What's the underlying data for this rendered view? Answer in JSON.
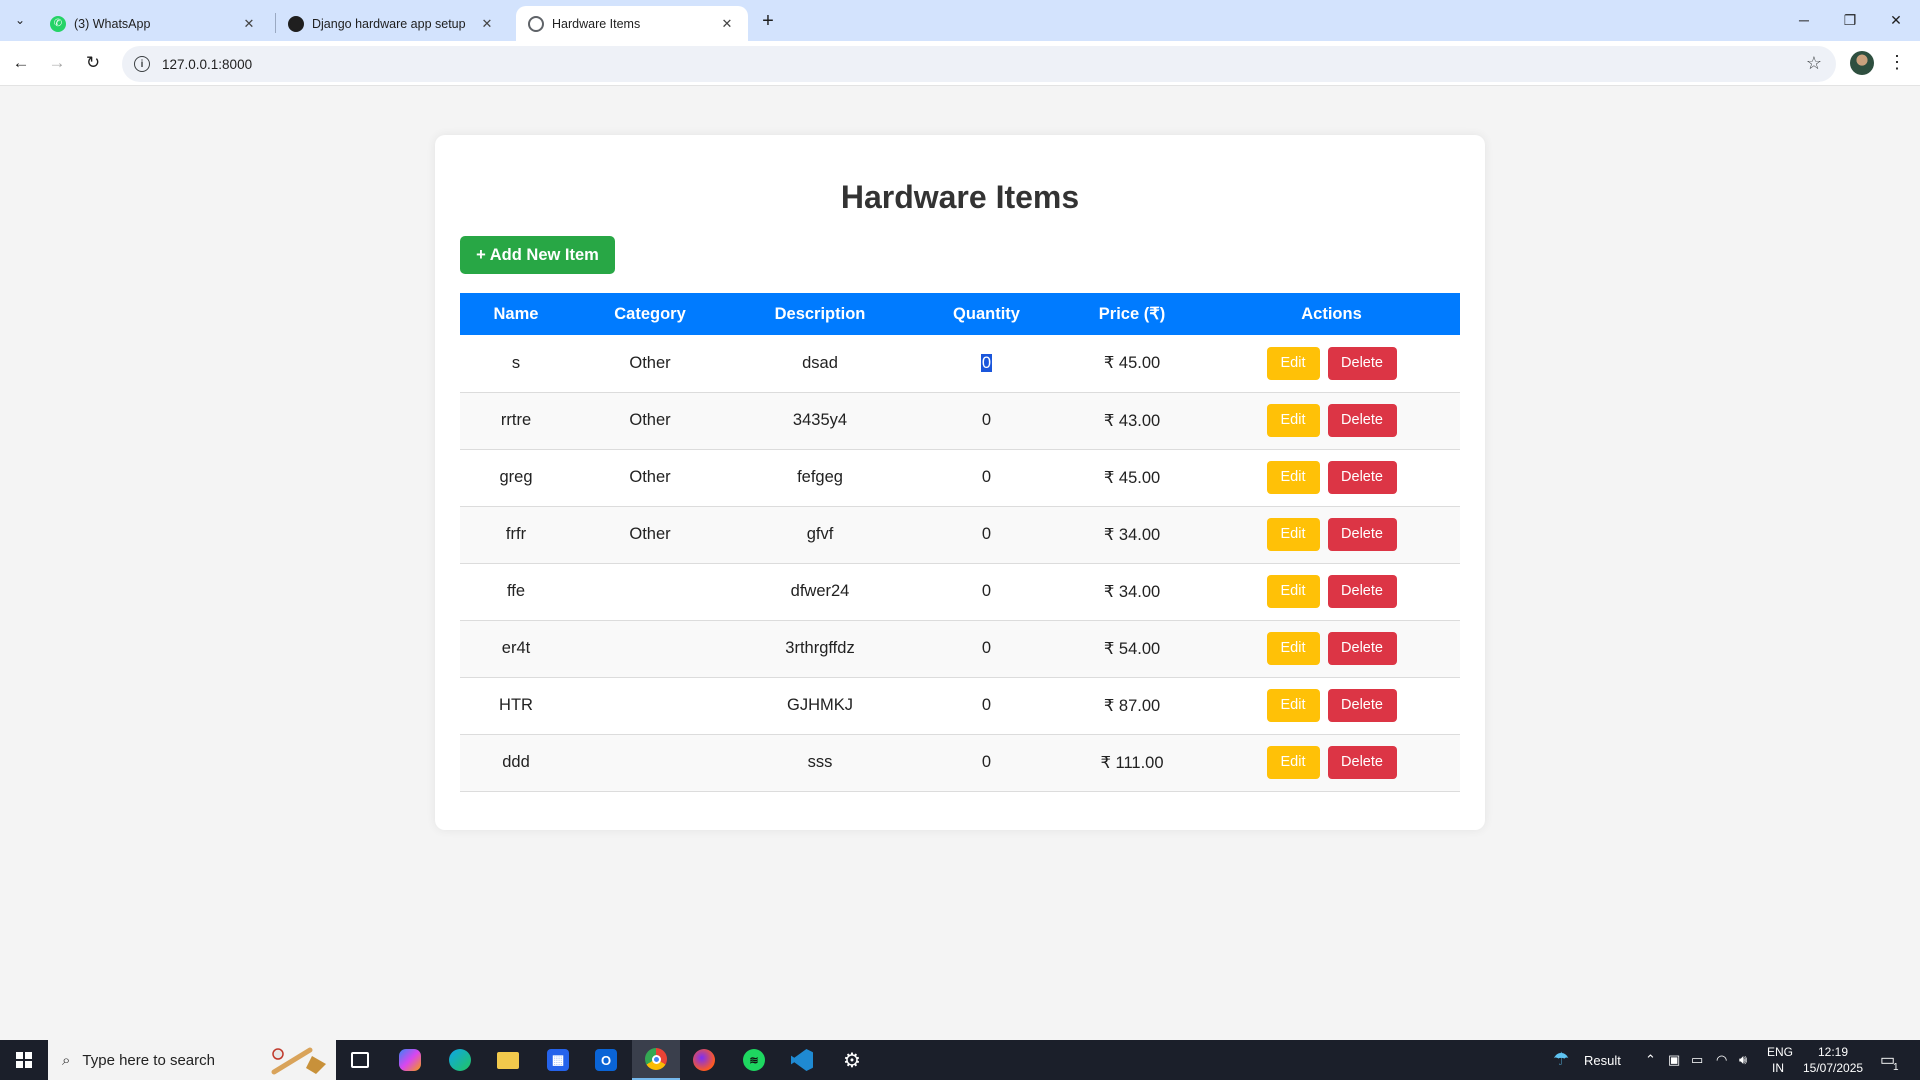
{
  "browser": {
    "tabs": [
      {
        "title": "(3) WhatsApp",
        "favicon": "whatsapp-icon",
        "active": false
      },
      {
        "title": "Django hardware app setup",
        "favicon": "chatgpt-icon",
        "active": false
      },
      {
        "title": "Hardware Items",
        "favicon": "globe-icon",
        "active": true
      }
    ],
    "url": "127.0.0.1:8000"
  },
  "page": {
    "title": "Hardware Items",
    "add_button": "+ Add New Item",
    "columns": [
      "Name",
      "Category",
      "Description",
      "Quantity",
      "Price (₹)",
      "Actions"
    ],
    "rows": [
      {
        "name": "s",
        "category": "Other",
        "description": "dsad",
        "quantity": "0",
        "price": "₹ 45.00"
      },
      {
        "name": "rrtre",
        "category": "Other",
        "description": "3435y4",
        "quantity": "0",
        "price": "₹ 43.00"
      },
      {
        "name": "greg",
        "category": "Other",
        "description": "fefgeg",
        "quantity": "0",
        "price": "₹ 45.00"
      },
      {
        "name": "frfr",
        "category": "Other",
        "description": "gfvf",
        "quantity": "0",
        "price": "₹ 34.00"
      },
      {
        "name": "ffe",
        "category": "",
        "description": "dfwer24",
        "quantity": "0",
        "price": "₹ 34.00"
      },
      {
        "name": "er4t",
        "category": "",
        "description": "3rthrgffdz",
        "quantity": "0",
        "price": "₹ 54.00"
      },
      {
        "name": "HTR",
        "category": "",
        "description": "GJHMKJ",
        "quantity": "0",
        "price": "₹ 87.00"
      },
      {
        "name": "ddd",
        "category": "",
        "description": "sss",
        "quantity": "0",
        "price": "₹ 111.00"
      }
    ],
    "edit_label": "Edit",
    "delete_label": "Delete",
    "colors": {
      "header": "#007bff",
      "add": "#28a745",
      "edit": "#ffc107",
      "delete": "#dc3545"
    }
  },
  "taskbar": {
    "search_placeholder": "Type here to search",
    "weather_label": "Result",
    "lang_line1": "ENG",
    "lang_line2": "IN",
    "time": "12:19",
    "date": "15/07/2025",
    "notification_count": "1"
  }
}
